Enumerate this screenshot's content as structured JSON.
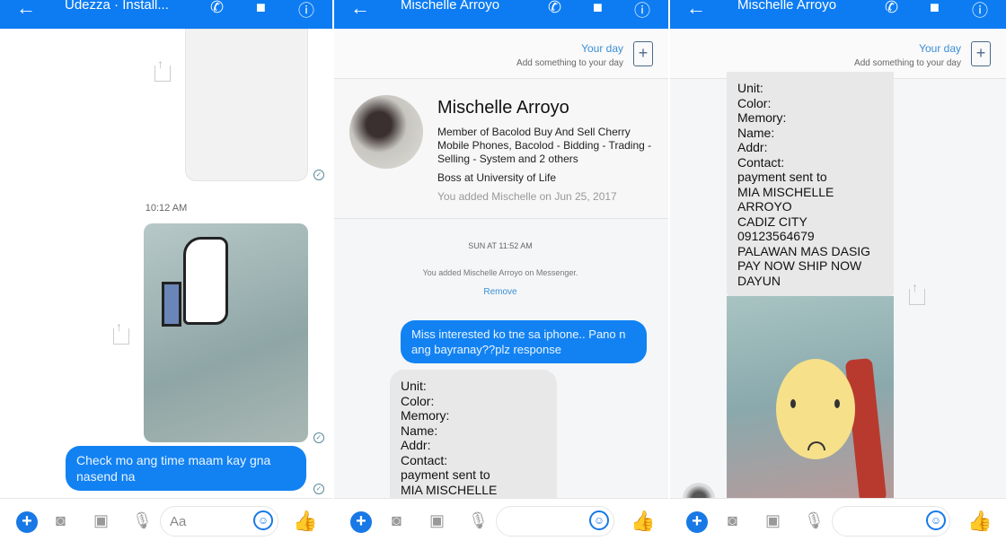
{
  "panels": [
    {
      "header": {
        "title": "Udezza · Install..."
      },
      "timestamp": "10:12 AM",
      "outgoing": "Check mo ang time maam kay gna nasend na",
      "input_placeholder": "Aa"
    },
    {
      "header": {
        "title": "Mischelle Arroyo"
      },
      "your_day": {
        "title": "Your day",
        "subtitle": "Add something to your day"
      },
      "profile": {
        "name": "Mischelle Arroyo",
        "member": "Member of Bacolod Buy And Sell Cherry Mobile Phones, Bacolod - Bidding - Trading - Selling - System and 2 others",
        "work": "Boss at University of Life",
        "added": "You added Mischelle on Jun 25, 2017"
      },
      "timestamp": "SUN AT 11:52 AM",
      "system_msg": "You added Mischelle Arroyo on Messenger.",
      "remove_label": "Remove",
      "outgoing": "Miss interested ko tne sa iphone.. Pano n ang bayranay??plz response",
      "incoming": "Unit:\nColor:\nMemory:\nName:\nAddr:\nContact:\npayment sent to\nMIA MISCHELLE\nARROYO"
    },
    {
      "header": {
        "title": "Mischelle Arroyo"
      },
      "your_day": {
        "title": "Your day",
        "subtitle": "Add something to your day"
      },
      "incoming": "Unit:\nColor:\nMemory:\nName:\nAddr:\nContact:\npayment sent to\nMIA MISCHELLE\nARROYO\nCADIZ CITY\n09123564679\nPALAWAN MAS DASIG\nPAY NOW SHIP NOW\nDAYUN"
    }
  ],
  "icons": {
    "back": "←",
    "phone": "✆",
    "video": "■",
    "info": "ⓘ",
    "plus": "+",
    "camera": "◙",
    "gallery": "▣",
    "mic": "🎙",
    "emoji": "☺",
    "like": "👍",
    "check": "✓"
  }
}
